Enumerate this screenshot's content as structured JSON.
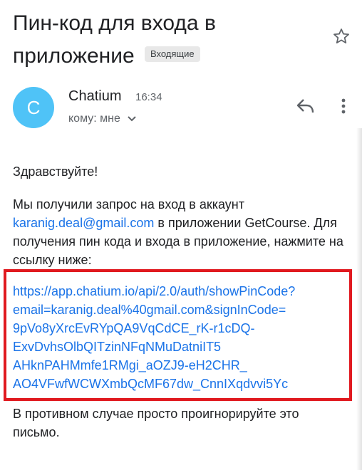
{
  "email": {
    "subject": "Пин-код для входа в приложение",
    "label_badge": "Входящие",
    "sender": {
      "name": "Chatium",
      "avatar_letter": "C",
      "avatar_color": "#4fc3f7",
      "time": "16:34",
      "recipient": "кому: мне"
    },
    "body": {
      "greeting": "Здравствуйте!",
      "para_before": "Мы получили запрос на вход в аккаунт",
      "email_address": "karanig.deal@gmail.com",
      "para_after": "в приложении GetCourse. Для получения пин кода и входа в приложение, нажмите на ссылку ниже:",
      "link_lines": [
        "https://app.chatium.io/api/2.0/auth/showPinCode?",
        "email=karanig.deal%40gmail.com&signInCode=",
        "9pVo8yXrcEvRYpQA9VqCdCE_rK-r1cDQ-",
        "ExvDvhsOlbQITzinNFqNMuDatniIT5",
        "AHknPAHMmfe1RMgi_aOZJ9-eH2CHR_",
        "AO4VFwfWCWXmbQcMF67dw_CnnIXqdvvi5Yc"
      ],
      "footer": "В противном случае просто проигнорируйте это письмо."
    }
  },
  "icons": {
    "star": "star-icon",
    "reply": "reply-icon",
    "more": "more-vert-icon",
    "chevron": "chevron-down-icon"
  },
  "colors": {
    "link": "#1a73e8",
    "highlight_border": "#e0191f",
    "badge_bg": "#e8e8e8"
  }
}
